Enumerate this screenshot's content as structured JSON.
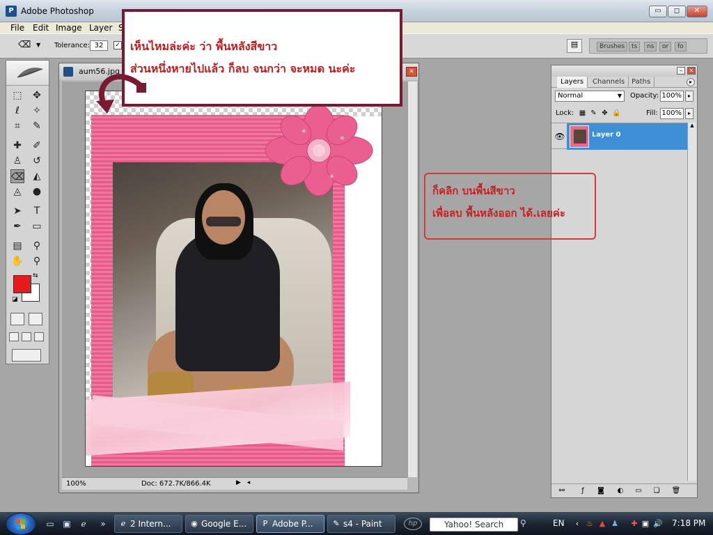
{
  "app": {
    "title": "Adobe Photoshop",
    "icon": "photoshop-icon"
  },
  "window_buttons": {
    "minimize": "▭",
    "maximize": "◻",
    "close": "✕"
  },
  "menu": [
    "File",
    "Edit",
    "Image",
    "Layer",
    "S"
  ],
  "options_bar": {
    "tool_icon": "magic-eraser-icon",
    "tolerance_label": "Tolerance:",
    "tolerance_value": "32",
    "antialias_checked": "✓"
  },
  "palette_well": {
    "tabs": [
      "Brushes",
      "ts",
      "ns",
      "or",
      "fo"
    ]
  },
  "document": {
    "name": "aum56.jpg",
    "zoom": "100%",
    "doc_size": "Doc: 672.7K/866.4K"
  },
  "annotations": {
    "note1_line1": "เห็นไหมล่ะค่ะ  ว่า  พื้นหลังสีขาว",
    "note1_line2": "ส่วนหนึ่งหายไปแล้ว  ก็ลบ  จนกว่า  จะหมด  นะค่ะ",
    "note2_line1": "ก็คลิก  บนพื้นสีขาว",
    "note2_line2": "เพื่อลบ  พื้นหลังออก  ได้.เลยค่ะ"
  },
  "layers_panel": {
    "tabs": [
      "Layers",
      "Channels",
      "Paths"
    ],
    "blend_mode": "Normal",
    "opacity_label": "Opacity:",
    "opacity_value": "100%",
    "lock_label": "Lock:",
    "fill_label": "Fill:",
    "fill_value": "100%",
    "layers": [
      {
        "name": "Layer 0",
        "visible": true,
        "selected": true
      }
    ]
  },
  "colors": {
    "foreground": "#e31b1b",
    "background": "#ffffff",
    "selection": "#3f8fd6",
    "annotation_text": "#c81a1a"
  },
  "taskbar": {
    "items": [
      {
        "label": "2 Intern...",
        "icon": "ie-icon"
      },
      {
        "label": "Google E...",
        "icon": "google-earth-icon"
      },
      {
        "label": "Adobe P...",
        "icon": "photoshop-icon"
      },
      {
        "label": "s4 - Paint",
        "icon": "paint-icon"
      }
    ],
    "search_placeholder": "Yahoo! Search",
    "language": "EN",
    "clock": "7:18 PM"
  }
}
